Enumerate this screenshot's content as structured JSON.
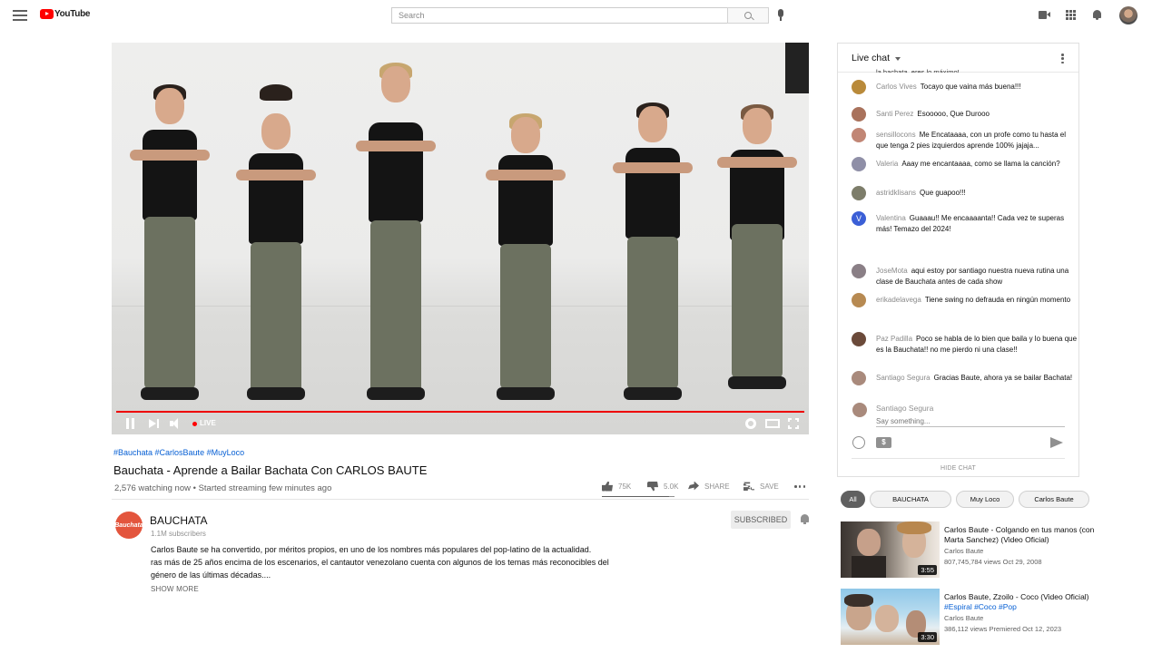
{
  "header": {
    "logo_text": "YouTube",
    "search_placeholder": "Search"
  },
  "player": {
    "live_label": "LIVE",
    "progress": 1.0
  },
  "video": {
    "hashtags": "#Bauchata #CarlosBaute #MuyLoco",
    "title": "Bauchata - Aprende a Bailar Bachata Con CARLOS BAUTE",
    "watching": "2,576 watching now • Started streaming few minutes ago",
    "likes": "75K",
    "dislikes": "5.0K",
    "share_label": "SHARE",
    "save_label": "SAVE"
  },
  "channel": {
    "avatar_text": "Bauchata",
    "name": "BAUCHATA",
    "subscribers": "1.1M subscribers",
    "subscribe_label": "SUBSCRIBED",
    "description": [
      "Carlos Baute se ha convertido, por méritos propios, en uno de los nombres más populares del pop-latino de la actualidad.",
      "ras más de 25 años encima de los escenarios, el cantautor venezolano cuenta con algunos de los temas más reconocibles del",
      " género de las últimas décadas...."
    ],
    "show_more": "SHOW MORE"
  },
  "chat": {
    "title": "Live chat",
    "cut_text": "la bachata, eres lo máximo!",
    "messages": [
      {
        "author": "Carlos Vives",
        "text": "Tocayo que vaina más buena!!!",
        "avatar": "#b98a3a"
      },
      {
        "author": "Santi Perez",
        "text": "Esooooo, Que Durooo",
        "avatar": "#a9725c"
      },
      {
        "author": "sensillocons",
        "text": "Me Encataaaa, con un profe como tu hasta el que tenga 2 pies izquierdos aprende 100% jajaja...",
        "avatar": "#c18675"
      },
      {
        "author": "Valeria",
        "text": "Aaay me encantaaaa, como se llama la canción?",
        "avatar": "#8f8fa7"
      },
      {
        "author": "astridklisans",
        "text": "Que guapoo!!!",
        "avatar": "#7d7d6a"
      },
      {
        "author": "Valentina",
        "text": "Guaaau!! Me encaaaanta!! Cada vez te superas más! Temazo del 2024!",
        "avatar": "#3b5fd6",
        "initial": "V"
      },
      {
        "author": "JoseMota",
        "text": "aqui estoy por santiago nuestra nueva rutina una clase de Bauchata antes de cada show",
        "avatar": "#8a7f86"
      },
      {
        "author": "erikadelavega",
        "text": "Tiene swing no defrauda en ningún momento",
        "avatar": "#b78a52"
      },
      {
        "author": "Paz Padilla",
        "text": "Poco se habla de lo bien que baila y lo buena que es la Bauchata!! no me pierdo ni una clase!!",
        "avatar": "#6b4a3a"
      },
      {
        "author": "Santiago Segura",
        "text": "Gracias Baute, ahora ya se bailar Bachata!",
        "avatar": "#a98a7c"
      }
    ],
    "me_name": "Santiago Segura",
    "input_placeholder": "Say something...",
    "superchat_symbol": "$",
    "hide_label": "HIDE CHAT"
  },
  "chips": [
    "All",
    "BAUCHATA",
    "Muy Loco",
    "Carlos Baute"
  ],
  "recommendations": [
    {
      "title": "Carlos Baute - Colgando en tus manos (con Marta Sanchez) (Video Oficial)",
      "tags": "",
      "channel": "Carlos Baute",
      "meta": "807,745,784 views   Oct 29, 2008",
      "duration": "3:55"
    },
    {
      "title": "Carlos Baute, Zzoilo - Coco (Video Oficial)",
      "tags": "#Espiral #Coco #Pop",
      "channel": "Carlos Baute",
      "meta": "386,112 views   Premiered Oct 12, 2023",
      "duration": "3:30"
    }
  ],
  "colors": {
    "brand_red": "#ff0000",
    "link_blue": "#065fd4",
    "progress_red": "#e00000"
  },
  "icons": [
    "menu-icon",
    "search-icon",
    "mic-icon",
    "create-video-icon",
    "apps-icon",
    "bell-icon",
    "pause-icon",
    "next-icon",
    "volume-icon",
    "settings-icon",
    "theater-icon",
    "fullscreen-icon",
    "thumb-up-icon",
    "thumb-down-icon",
    "share-icon",
    "save-icon",
    "more-icon",
    "emoji-icon",
    "send-icon"
  ]
}
